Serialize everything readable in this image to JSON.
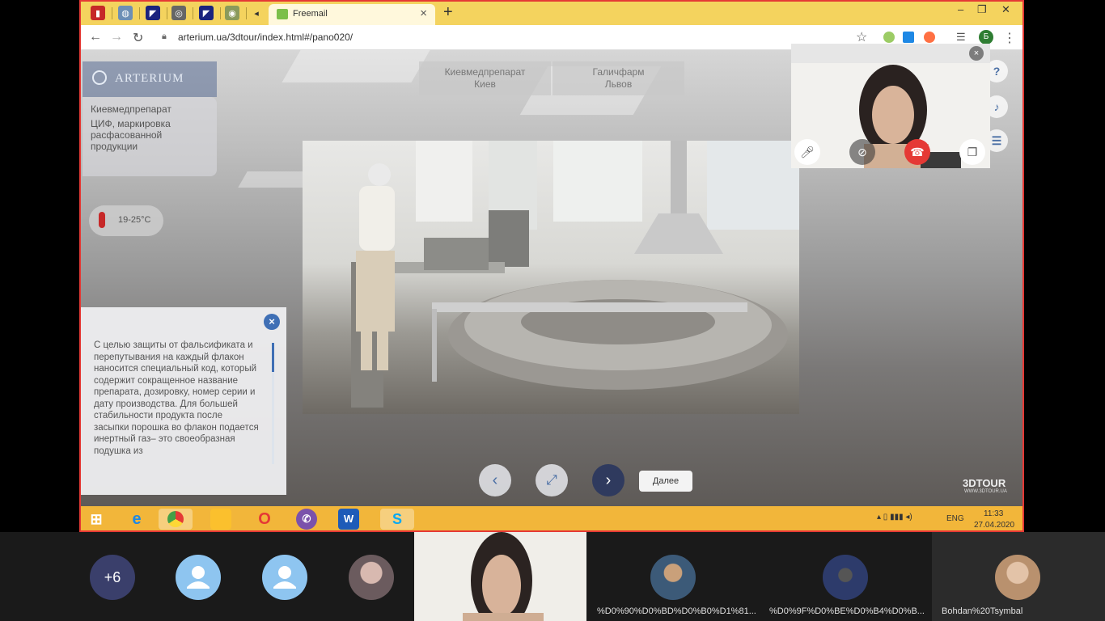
{
  "browser": {
    "active_tab_title": "Freemail",
    "tab_close": "×",
    "new_tab": "+",
    "url": "arterium.ua/3dtour/index.html#/pano020/",
    "profile_initial": "Б",
    "window_controls": [
      "–",
      "❐",
      "✕"
    ]
  },
  "tour": {
    "logo": "ARTERIUM",
    "info_card": {
      "title": "Киевмедпрепарат",
      "subtitle": "ЦИФ, маркировка расфасованной продукции"
    },
    "temperature": "19-25°C",
    "locations": [
      {
        "line1": "Киевмедпрепарат",
        "line2": "Киев"
      },
      {
        "line1": "Галичфарм",
        "line2": "Львов"
      }
    ],
    "side_buttons": [
      "?",
      "♪",
      "☰"
    ],
    "description": "С целью защиты от фальсификата и перепутывания на каждый флакон наносится специальный код, который содержит сокращенное название препарата, дозировку, номер серии и дату производства. Для большей стабильности продукта после засыпки порошка во флакон подается инертный газ– это своеобразная подушка из",
    "panel_close": "×",
    "nav": {
      "prev": "‹",
      "fullscreen": "⤢",
      "next": "›",
      "next_label": "Далее"
    },
    "brand": "3DTOUR",
    "brand_sub": "WWW.3DTOUR.UA"
  },
  "call": {
    "close": "×"
  },
  "taskbar": {
    "lang": "ENG",
    "time": "11:33",
    "date": "27.04.2020",
    "tray": "▴  ▯  ▮▮▮  ◂)"
  },
  "participants": [
    {
      "label": "+6",
      "kind": "count",
      "color": "#3a3f6b"
    },
    {
      "label": "",
      "kind": "default",
      "color": "#8ec5f0"
    },
    {
      "label": "",
      "kind": "default",
      "color": "#8ec5f0"
    },
    {
      "label": "",
      "kind": "photo",
      "color": "#6b5b5e"
    },
    {
      "label": "%D0%90%D0%BD%D0%B0%D1%81...",
      "kind": "photo",
      "color": "#3c5a78"
    },
    {
      "label": "%D0%9F%D0%BE%D0%B4%D0%B...",
      "kind": "photo",
      "color": "#2d3b6b"
    },
    {
      "label": "Bohdan%20Tsymbal",
      "kind": "photo",
      "color": "#b9916e"
    }
  ]
}
